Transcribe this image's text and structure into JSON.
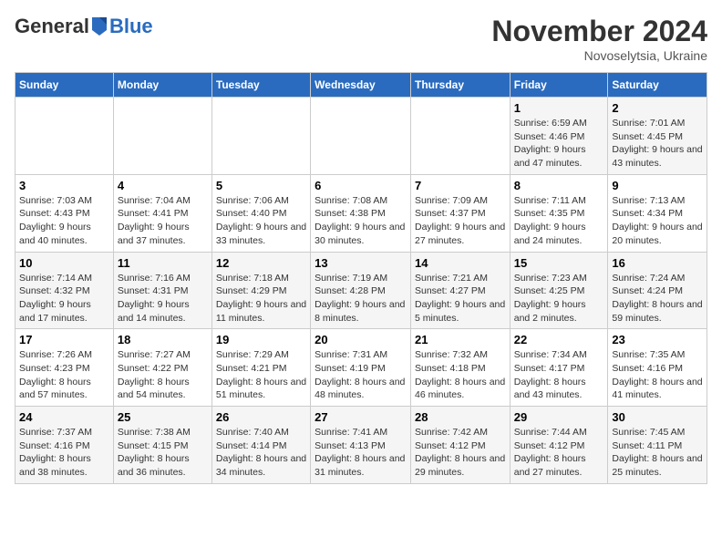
{
  "logo": {
    "text_general": "General",
    "text_blue": "Blue"
  },
  "header": {
    "title": "November 2024",
    "location": "Novoselytsia, Ukraine"
  },
  "weekdays": [
    "Sunday",
    "Monday",
    "Tuesday",
    "Wednesday",
    "Thursday",
    "Friday",
    "Saturday"
  ],
  "weeks": [
    [
      {
        "day": "",
        "info": ""
      },
      {
        "day": "",
        "info": ""
      },
      {
        "day": "",
        "info": ""
      },
      {
        "day": "",
        "info": ""
      },
      {
        "day": "",
        "info": ""
      },
      {
        "day": "1",
        "info": "Sunrise: 6:59 AM\nSunset: 4:46 PM\nDaylight: 9 hours and 47 minutes."
      },
      {
        "day": "2",
        "info": "Sunrise: 7:01 AM\nSunset: 4:45 PM\nDaylight: 9 hours and 43 minutes."
      }
    ],
    [
      {
        "day": "3",
        "info": "Sunrise: 7:03 AM\nSunset: 4:43 PM\nDaylight: 9 hours and 40 minutes."
      },
      {
        "day": "4",
        "info": "Sunrise: 7:04 AM\nSunset: 4:41 PM\nDaylight: 9 hours and 37 minutes."
      },
      {
        "day": "5",
        "info": "Sunrise: 7:06 AM\nSunset: 4:40 PM\nDaylight: 9 hours and 33 minutes."
      },
      {
        "day": "6",
        "info": "Sunrise: 7:08 AM\nSunset: 4:38 PM\nDaylight: 9 hours and 30 minutes."
      },
      {
        "day": "7",
        "info": "Sunrise: 7:09 AM\nSunset: 4:37 PM\nDaylight: 9 hours and 27 minutes."
      },
      {
        "day": "8",
        "info": "Sunrise: 7:11 AM\nSunset: 4:35 PM\nDaylight: 9 hours and 24 minutes."
      },
      {
        "day": "9",
        "info": "Sunrise: 7:13 AM\nSunset: 4:34 PM\nDaylight: 9 hours and 20 minutes."
      }
    ],
    [
      {
        "day": "10",
        "info": "Sunrise: 7:14 AM\nSunset: 4:32 PM\nDaylight: 9 hours and 17 minutes."
      },
      {
        "day": "11",
        "info": "Sunrise: 7:16 AM\nSunset: 4:31 PM\nDaylight: 9 hours and 14 minutes."
      },
      {
        "day": "12",
        "info": "Sunrise: 7:18 AM\nSunset: 4:29 PM\nDaylight: 9 hours and 11 minutes."
      },
      {
        "day": "13",
        "info": "Sunrise: 7:19 AM\nSunset: 4:28 PM\nDaylight: 9 hours and 8 minutes."
      },
      {
        "day": "14",
        "info": "Sunrise: 7:21 AM\nSunset: 4:27 PM\nDaylight: 9 hours and 5 minutes."
      },
      {
        "day": "15",
        "info": "Sunrise: 7:23 AM\nSunset: 4:25 PM\nDaylight: 9 hours and 2 minutes."
      },
      {
        "day": "16",
        "info": "Sunrise: 7:24 AM\nSunset: 4:24 PM\nDaylight: 8 hours and 59 minutes."
      }
    ],
    [
      {
        "day": "17",
        "info": "Sunrise: 7:26 AM\nSunset: 4:23 PM\nDaylight: 8 hours and 57 minutes."
      },
      {
        "day": "18",
        "info": "Sunrise: 7:27 AM\nSunset: 4:22 PM\nDaylight: 8 hours and 54 minutes."
      },
      {
        "day": "19",
        "info": "Sunrise: 7:29 AM\nSunset: 4:21 PM\nDaylight: 8 hours and 51 minutes."
      },
      {
        "day": "20",
        "info": "Sunrise: 7:31 AM\nSunset: 4:19 PM\nDaylight: 8 hours and 48 minutes."
      },
      {
        "day": "21",
        "info": "Sunrise: 7:32 AM\nSunset: 4:18 PM\nDaylight: 8 hours and 46 minutes."
      },
      {
        "day": "22",
        "info": "Sunrise: 7:34 AM\nSunset: 4:17 PM\nDaylight: 8 hours and 43 minutes."
      },
      {
        "day": "23",
        "info": "Sunrise: 7:35 AM\nSunset: 4:16 PM\nDaylight: 8 hours and 41 minutes."
      }
    ],
    [
      {
        "day": "24",
        "info": "Sunrise: 7:37 AM\nSunset: 4:16 PM\nDaylight: 8 hours and 38 minutes."
      },
      {
        "day": "25",
        "info": "Sunrise: 7:38 AM\nSunset: 4:15 PM\nDaylight: 8 hours and 36 minutes."
      },
      {
        "day": "26",
        "info": "Sunrise: 7:40 AM\nSunset: 4:14 PM\nDaylight: 8 hours and 34 minutes."
      },
      {
        "day": "27",
        "info": "Sunrise: 7:41 AM\nSunset: 4:13 PM\nDaylight: 8 hours and 31 minutes."
      },
      {
        "day": "28",
        "info": "Sunrise: 7:42 AM\nSunset: 4:12 PM\nDaylight: 8 hours and 29 minutes."
      },
      {
        "day": "29",
        "info": "Sunrise: 7:44 AM\nSunset: 4:12 PM\nDaylight: 8 hours and 27 minutes."
      },
      {
        "day": "30",
        "info": "Sunrise: 7:45 AM\nSunset: 4:11 PM\nDaylight: 8 hours and 25 minutes."
      }
    ]
  ]
}
